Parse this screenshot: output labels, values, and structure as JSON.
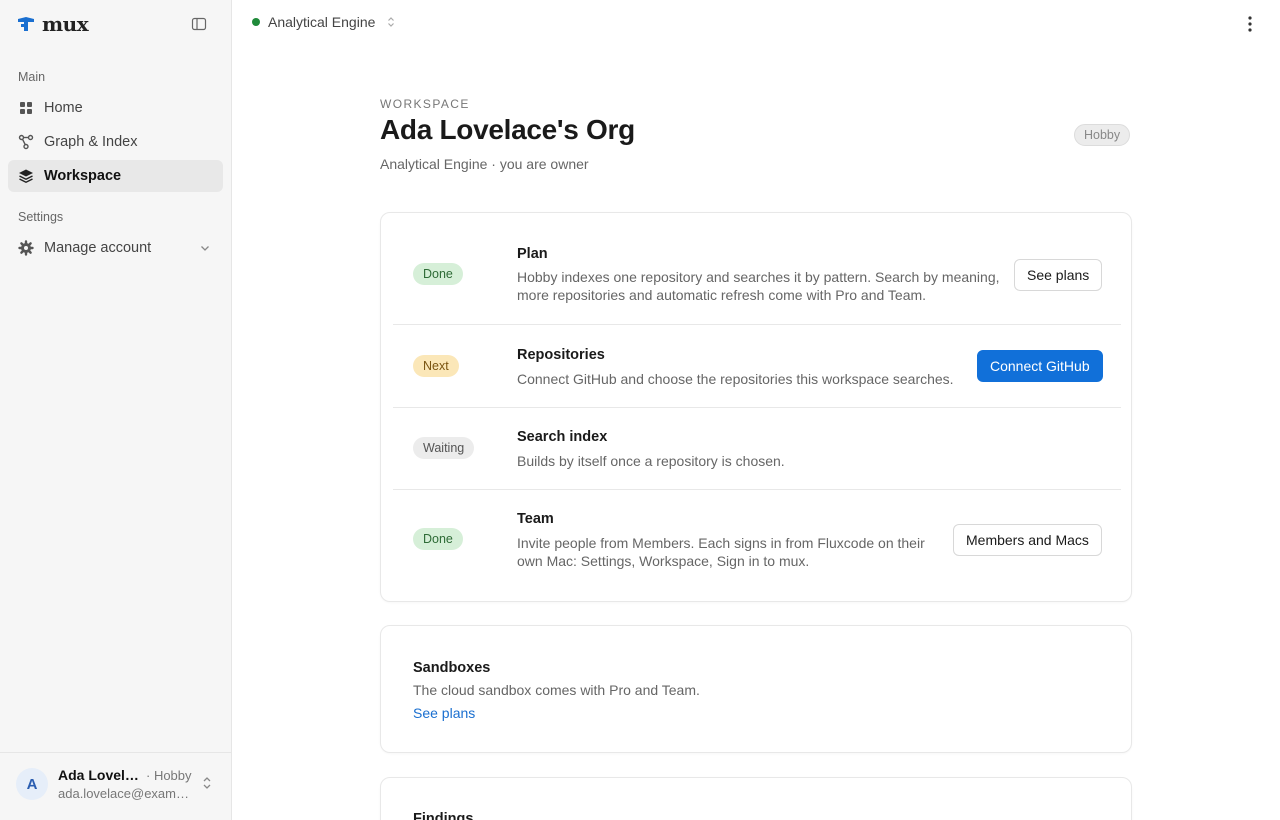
{
  "brand": {
    "name": "mux"
  },
  "sidebar": {
    "main_label": "Main",
    "items": [
      {
        "label": "Home",
        "icon": "grid-icon"
      },
      {
        "label": "Graph & Index",
        "icon": "graph-icon"
      },
      {
        "label": "Workspace",
        "icon": "layers-icon",
        "active": true
      }
    ],
    "settings_label": "Settings",
    "settings_items": [
      {
        "label": "Manage account",
        "icon": "gear-icon"
      }
    ]
  },
  "user": {
    "initial": "A",
    "name": "Ada Lovelace",
    "plan": "· Hobby",
    "email": "ada.lovelace@example.com"
  },
  "topbar": {
    "project": "Analytical Engine",
    "status_color": "#1f8a3a"
  },
  "header": {
    "eyebrow": "WORKSPACE",
    "title": "Ada Lovelace's Org",
    "subtitle": "Analytical Engine · you are owner",
    "plan_badge": "Hobby"
  },
  "steps": [
    {
      "status": "Done",
      "title": "Plan",
      "description": "Hobby indexes one repository and searches it by pattern. Search by meaning, more repositories and automatic refresh come with Pro and Team.",
      "action": "See plans"
    },
    {
      "status": "Next",
      "title": "Repositories",
      "description": "Connect GitHub and choose the repositories this workspace searches.",
      "action": "Connect GitHub"
    },
    {
      "status": "Waiting",
      "title": "Search index",
      "description": "Builds by itself once a repository is chosen."
    },
    {
      "status": "Done",
      "title": "Team",
      "description": "Invite people from Members. Each signs in from Fluxcode on their own Mac: Settings, Workspace, Sign in to mux.",
      "action": "Members and Macs"
    }
  ],
  "sandboxes": {
    "title": "Sandboxes",
    "description": "The cloud sandbox comes with Pro and Team.",
    "link": "See plans"
  },
  "findings": {
    "title": "Findings"
  },
  "colors": {
    "accent": "#1170d9",
    "done": "#d6efd8",
    "next": "#fbe7b8",
    "waiting": "#ececec"
  }
}
